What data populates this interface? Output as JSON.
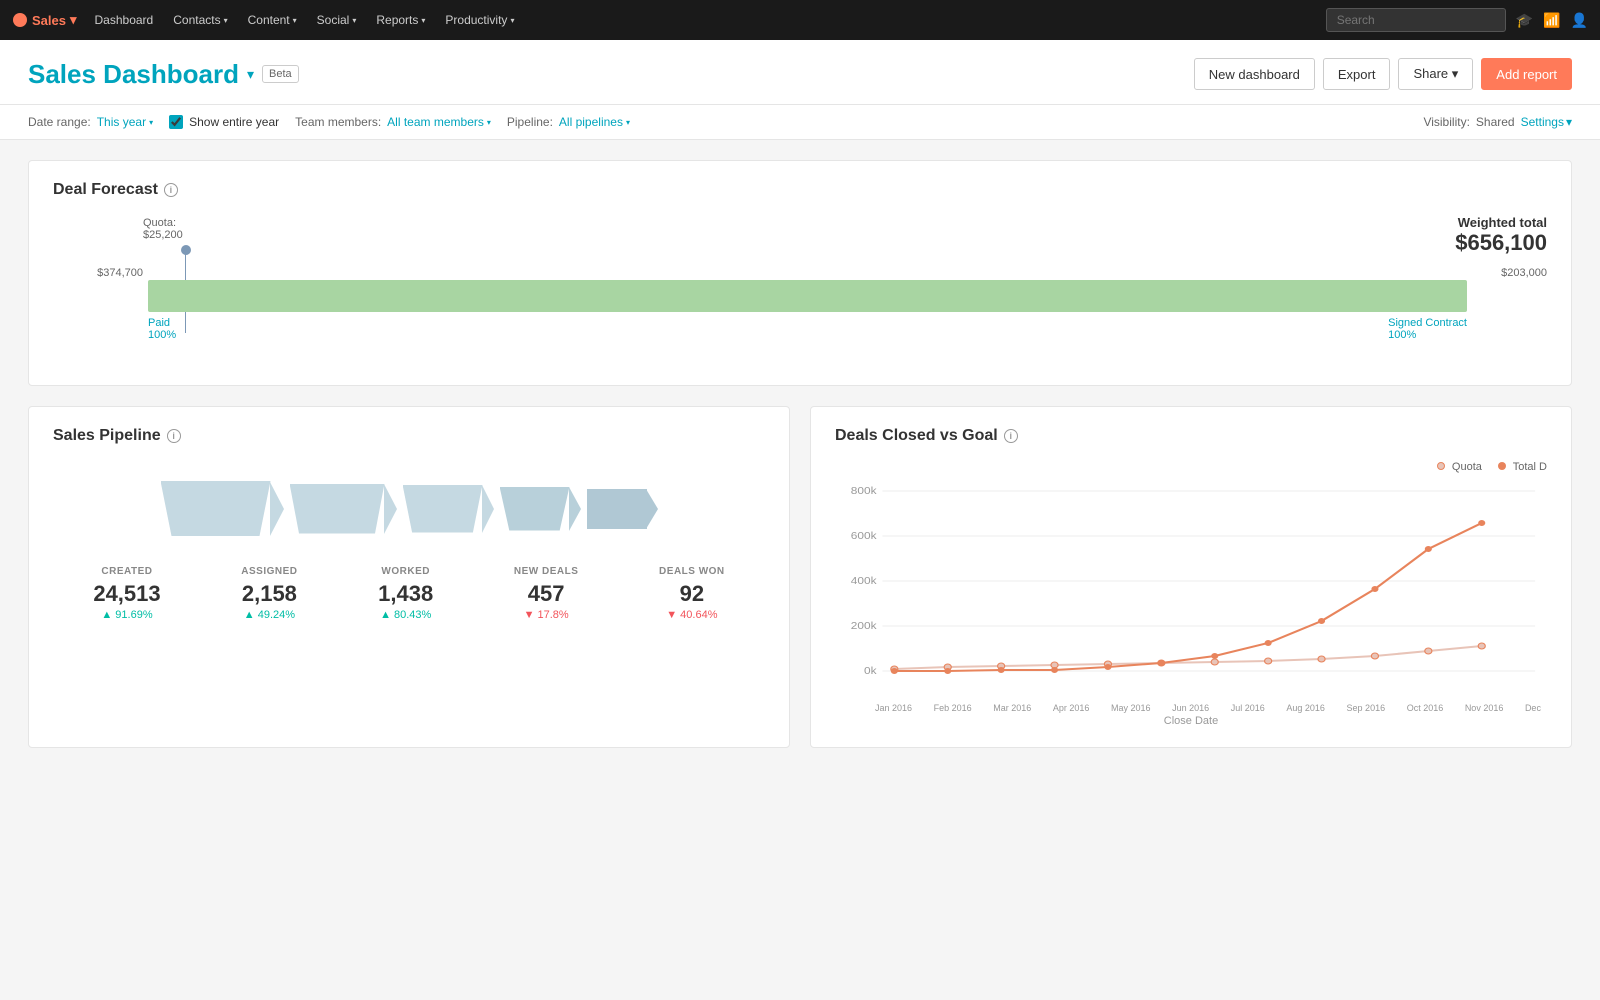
{
  "nav": {
    "brand": "Sales",
    "items": [
      {
        "label": "Dashboard",
        "hasDropdown": false
      },
      {
        "label": "Contacts",
        "hasDropdown": true
      },
      {
        "label": "Content",
        "hasDropdown": true
      },
      {
        "label": "Social",
        "hasDropdown": true
      },
      {
        "label": "Reports",
        "hasDropdown": true
      },
      {
        "label": "Productivity",
        "hasDropdown": true
      }
    ],
    "search_placeholder": "Search"
  },
  "header": {
    "title": "Sales Dashboard",
    "beta_label": "Beta",
    "buttons": {
      "new_dashboard": "New dashboard",
      "export": "Export",
      "share": "Share",
      "add_report": "Add report"
    }
  },
  "filters": {
    "date_range_label": "Date range:",
    "date_range_value": "This year",
    "show_entire_year": "Show entire year",
    "team_members_label": "Team members:",
    "team_members_value": "All team members",
    "pipeline_label": "Pipeline:",
    "pipeline_value": "All pipelines",
    "visibility_label": "Visibility:",
    "visibility_value": "Shared",
    "settings_label": "Settings"
  },
  "deal_forecast": {
    "title": "Deal Forecast",
    "weighted_total_label": "Weighted total",
    "weighted_total_value": "$656,100",
    "quota_label": "Quota:",
    "quota_amount": "$25,200",
    "left_amount": "$374,700",
    "right_amount": "$203,000",
    "segments": [
      {
        "name": "Paid",
        "pct": "100%"
      },
      {
        "name": "Signed Contract",
        "pct": "100%"
      }
    ]
  },
  "sales_pipeline": {
    "title": "Sales Pipeline",
    "stats": [
      {
        "label": "Created",
        "value": "24,513",
        "change": "91.69%",
        "up": true
      },
      {
        "label": "Assigned",
        "value": "2,158",
        "change": "49.24%",
        "up": true
      },
      {
        "label": "Worked",
        "value": "1,438",
        "change": "80.43%",
        "up": true
      },
      {
        "label": "New Deals",
        "value": "457",
        "change": "17.8%",
        "up": false
      },
      {
        "label": "Deals Won",
        "value": "92",
        "change": "40.64%",
        "up": false
      }
    ]
  },
  "deals_closed": {
    "title": "Deals Closed vs Goal",
    "legend": [
      {
        "label": "Quota",
        "color": "#e8c4b8"
      },
      {
        "label": "Total D",
        "color": "#e8845c"
      }
    ],
    "y_labels": [
      "800k",
      "600k",
      "400k",
      "200k",
      "0k"
    ],
    "x_labels": [
      "Jan 2016",
      "Feb 2016",
      "Mar 2016",
      "Apr 2016",
      "May 2016",
      "Jun 2016",
      "Jul 2016",
      "Aug 2016",
      "Sep 2016",
      "Oct 2016",
      "Nov 2016",
      "Dec"
    ],
    "x_axis_label": "Close Date",
    "quota_points": [
      2,
      2,
      2,
      2,
      2,
      2,
      2,
      2,
      3,
      4,
      5,
      6
    ],
    "total_points": [
      0,
      0,
      1,
      1,
      2,
      3,
      4,
      6,
      10,
      16,
      22,
      26
    ]
  }
}
